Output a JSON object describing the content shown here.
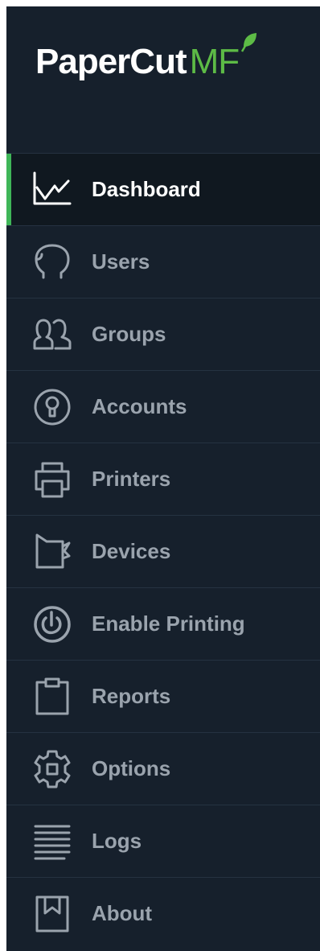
{
  "brand": {
    "name_main": "PaperCut",
    "name_suffix": "MF",
    "accent_color": "#5dbb46"
  },
  "colors": {
    "sidebar_bg": "#16202c",
    "active_bg": "#101820",
    "active_indicator": "#3fb658",
    "label": "#9aa3ad",
    "label_active": "#ffffff"
  },
  "nav": {
    "active": "Dashboard",
    "items": [
      {
        "label": "Dashboard",
        "icon": "dashboard-chart-icon"
      },
      {
        "label": "Users",
        "icon": "user-head-icon"
      },
      {
        "label": "Groups",
        "icon": "group-icon"
      },
      {
        "label": "Accounts",
        "icon": "account-icon"
      },
      {
        "label": "Printers",
        "icon": "printer-icon"
      },
      {
        "label": "Devices",
        "icon": "device-icon"
      },
      {
        "label": "Enable Printing",
        "icon": "enable-printing-icon"
      },
      {
        "label": "Reports",
        "icon": "clipboard-icon"
      },
      {
        "label": "Options",
        "icon": "gear-icon"
      },
      {
        "label": "Logs",
        "icon": "logs-icon"
      },
      {
        "label": "About",
        "icon": "about-icon"
      }
    ]
  }
}
